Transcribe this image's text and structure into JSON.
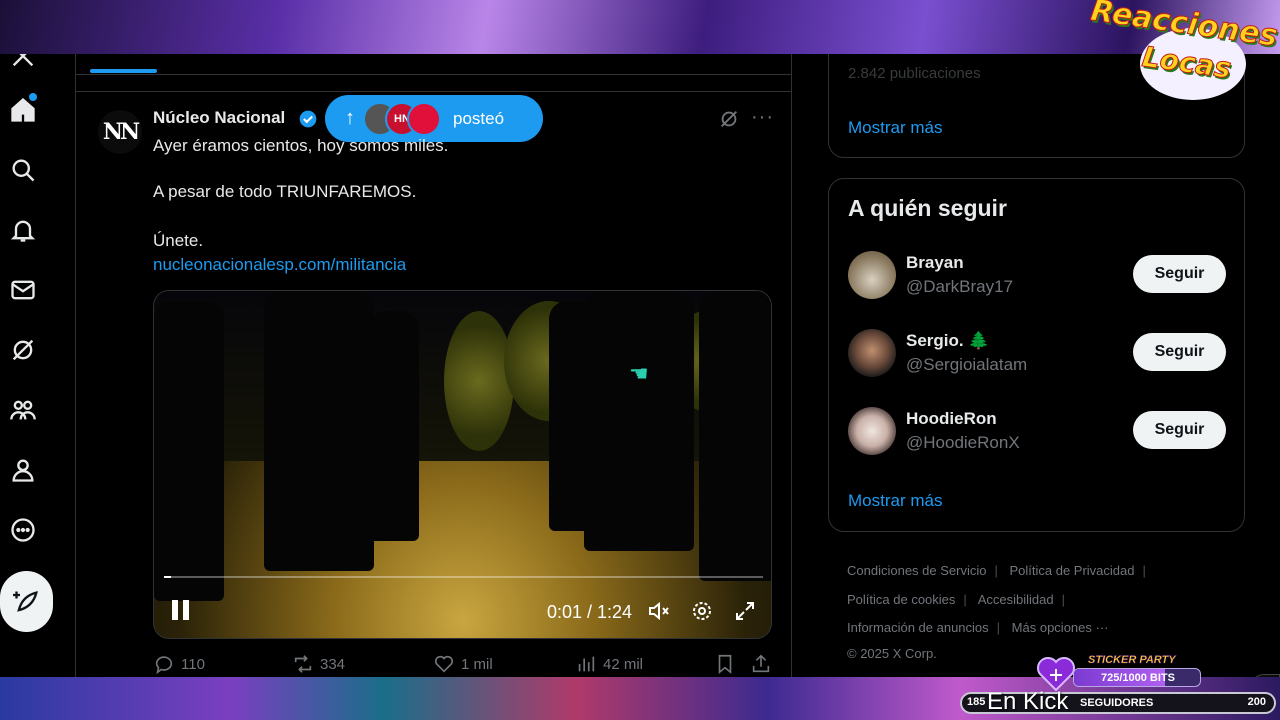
{
  "tweet": {
    "author": "Núcleo Nacional",
    "avatar_text": "NN",
    "line1": "Ayer éramos cientos, hoy somos miles.",
    "line2": "A pesar de todo TRIUNFAREMOS.",
    "line3": "Únete.",
    "link": "nucleonacionalesp.com/militancia",
    "posted_pill": {
      "label": "posteó",
      "badge": "HN"
    },
    "video": {
      "time": "0:01 / 1:24",
      "progress": 0.012
    },
    "actions": {
      "replies": "110",
      "reposts": "334",
      "likes": "1 mil",
      "views": "42 mil"
    }
  },
  "right": {
    "top_box_faded": "2.842 publicaciones",
    "show_more_1": "Mostrar más",
    "who_to_follow_title": "A quién seguir",
    "follow_suggestions": [
      {
        "name": "Brayan",
        "handle": "@DarkBray17",
        "button": "Seguir"
      },
      {
        "name": "Sergio. 🌲",
        "handle": "@Sergioialatam",
        "button": "Seguir"
      },
      {
        "name": "HoodieRon",
        "handle": "@HoodieRonX",
        "button": "Seguir"
      }
    ],
    "show_more_2": "Mostrar más",
    "footer": {
      "terms": "Condiciones de Servicio",
      "privacy": "Política de Privacidad",
      "cookies": "Política de cookies",
      "accessibility": "Accesibilidad",
      "ads_info": "Información de anuncios",
      "more_options": "Más opciones ···",
      "copyright": "© 2025 X Corp."
    }
  },
  "stream": {
    "logo_line1": "Reacciones",
    "logo_line2": "Locas",
    "kick_label": "En Kick",
    "sticker_title": "STICKER PARTY",
    "sticker_progress_text": "725/1000 BITS",
    "sticker_progress": 0.725,
    "followers_left": "185",
    "followers_label": "SEGUIDORES",
    "followers_right": "200"
  },
  "colors": {
    "accent": "#1d9bf0",
    "background": "#000000",
    "text": "#e7e9ea",
    "muted": "#71767b"
  }
}
